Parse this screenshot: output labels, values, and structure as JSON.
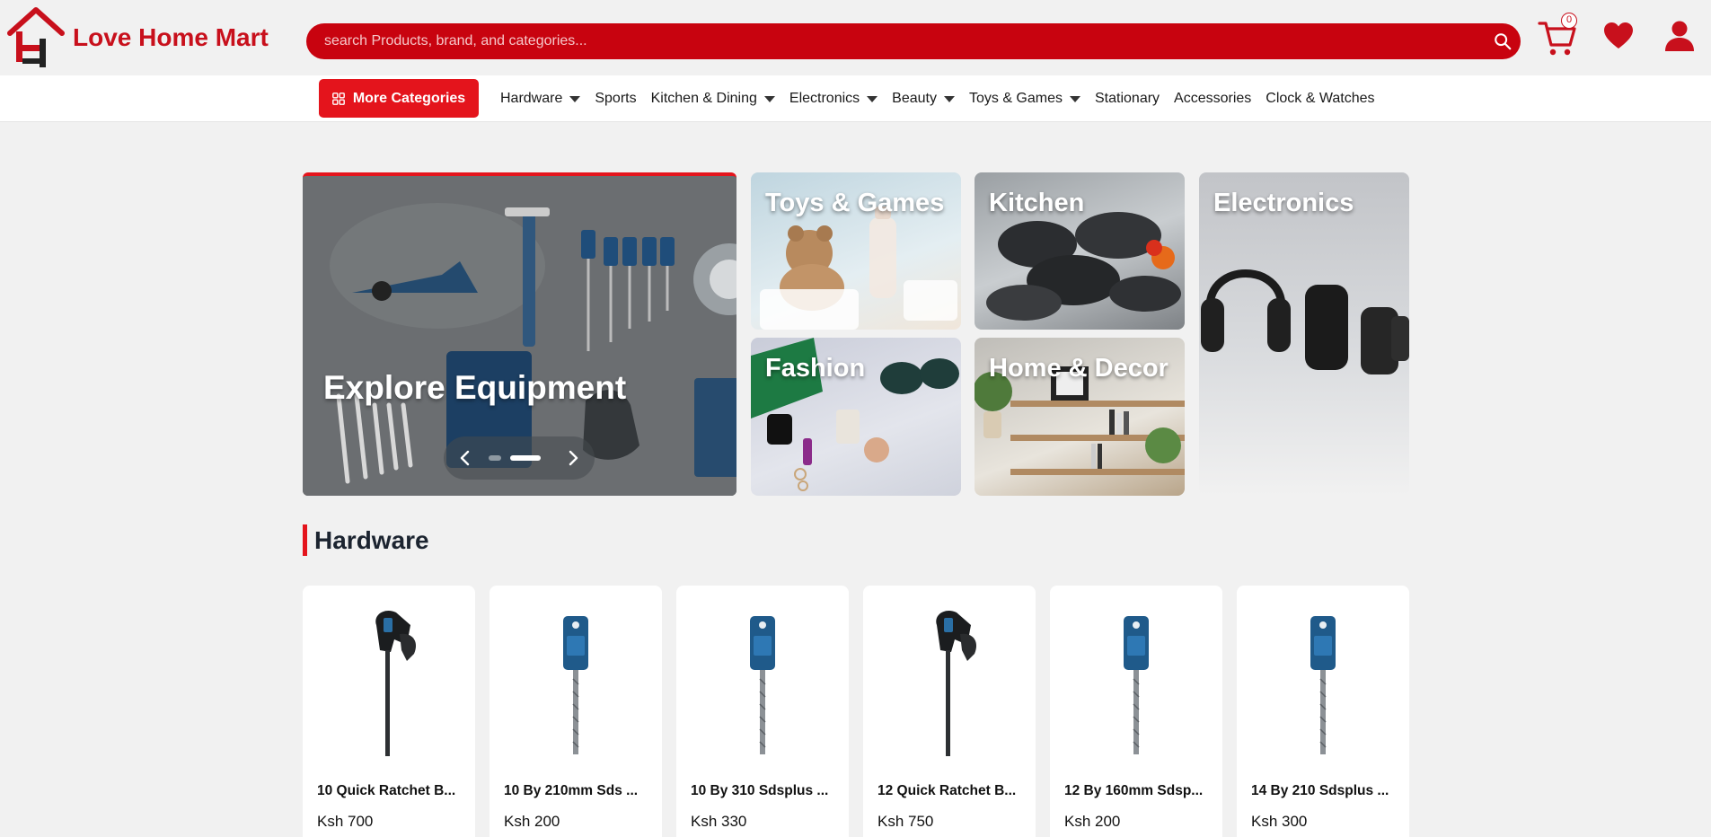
{
  "brand": {
    "name": "Love Home Mart"
  },
  "search": {
    "placeholder": "search Products, brand, and categories..."
  },
  "header": {
    "cart_count": "0"
  },
  "nav": {
    "more_categories": "More Categories",
    "items": [
      {
        "label": "Hardware",
        "dropdown": true
      },
      {
        "label": "Sports",
        "dropdown": false
      },
      {
        "label": "Kitchen & Dining",
        "dropdown": true
      },
      {
        "label": "Electronics",
        "dropdown": true
      },
      {
        "label": "Beauty",
        "dropdown": true
      },
      {
        "label": "Toys & Games",
        "dropdown": true
      },
      {
        "label": "Stationary",
        "dropdown": false
      },
      {
        "label": "Accessories",
        "dropdown": false
      },
      {
        "label": "Clock & Watches",
        "dropdown": false
      }
    ]
  },
  "hero": {
    "title": "Explore Equipment",
    "active_slide": 2,
    "slide_count": 2
  },
  "tiles": {
    "toys": "Toys & Games",
    "kitchen": "Kitchen",
    "electronics": "Electronics",
    "fashion": "Fashion",
    "home": "Home & Decor"
  },
  "section": {
    "title": "Hardware"
  },
  "products": [
    {
      "name": "10 Quick Ratchet B...",
      "price": "Ksh 700",
      "image": "clamp"
    },
    {
      "name": "10 By 210mm Sds ...",
      "price": "Ksh 200",
      "image": "drill-bit"
    },
    {
      "name": "10 By 310 Sdsplus ...",
      "price": "Ksh 330",
      "image": "drill-bit"
    },
    {
      "name": "12 Quick Ratchet B...",
      "price": "Ksh 750",
      "image": "clamp"
    },
    {
      "name": "12 By 160mm Sdsp...",
      "price": "Ksh 200",
      "image": "drill-bit"
    },
    {
      "name": "14 By 210 Sdsplus ...",
      "price": "Ksh 300",
      "image": "drill-bit"
    }
  ],
  "colors": {
    "brand_red": "#c8101c",
    "search_red": "#c8030f",
    "button_red": "#e4141c"
  }
}
